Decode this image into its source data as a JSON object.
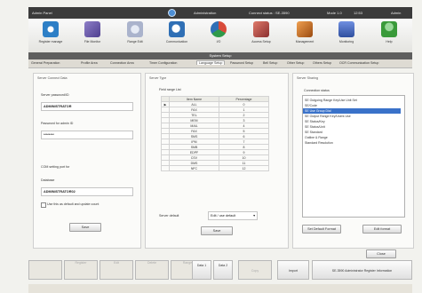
{
  "titlebar": {
    "left": "Admin Panel",
    "center": "Administration",
    "status": "Connect status : SE-3590",
    "mode": "Mode 1.0",
    "clock": "12:53",
    "right": "Admin"
  },
  "toolbar": [
    {
      "label": "Register manage",
      "icon": "register-icon",
      "color": "#2d7fc6"
    },
    {
      "label": "File Monitor",
      "icon": "user-icon",
      "color": "#6b5aa8"
    },
    {
      "label": "Range Edit",
      "icon": "range-icon",
      "color": "#aab3cc"
    },
    {
      "label": "Communication",
      "icon": "search-icon",
      "color": "#2f6fb5"
    },
    {
      "label": "I/O",
      "icon": "io-icon",
      "color": "#2f9a4a"
    },
    {
      "label": "Access Setup",
      "icon": "access-icon",
      "color": "#b04040"
    },
    {
      "label": "Management",
      "icon": "management-icon",
      "color": "#c46c20"
    },
    {
      "label": "Monitoring",
      "icon": "monitor-icon",
      "color": "#3f5fb5"
    },
    {
      "label": "Help",
      "icon": "help-icon",
      "color": "#3a9a3a"
    }
  ],
  "section_title": "System Setup",
  "tabs": [
    "General Preparation",
    "Profile Area",
    "Connection Area",
    "Timer Configuration",
    "Language Setup",
    "Password Setup",
    "Bell Setup",
    "Other Setup",
    "Others Setup",
    "OCR Communication Setup"
  ],
  "active_tab_index": 4,
  "left_panel": {
    "title": "Server Connect Data",
    "field1_label": "Server password/ID",
    "field1_value": "ADMINISTRATOR",
    "field2_label": "Password for admin ID",
    "field2_value": "********",
    "field3_label": "COM setting port for",
    "field4_label": "Database",
    "field4_value": "ADMINISTRATOR02",
    "checkbox_label": "Use this as default and update count",
    "save_label": "Save"
  },
  "middle_panel": {
    "title": "Server Type",
    "list_label": "Field range List",
    "columns": [
      "Item Name",
      "Percentage"
    ],
    "rows": [
      {
        "name": "ALL",
        "value": "0"
      },
      {
        "name": "FAX",
        "value": "1"
      },
      {
        "name": "TEL",
        "value": "2"
      },
      {
        "name": "MEM",
        "value": "3"
      },
      {
        "name": "MAIL",
        "value": "4"
      },
      {
        "name": "FAX",
        "value": "5"
      },
      {
        "name": "SMS",
        "value": "6"
      },
      {
        "name": "IPM",
        "value": "7"
      },
      {
        "name": "SMB",
        "value": "8"
      },
      {
        "name": "EDPF",
        "value": "9"
      },
      {
        "name": "CSV",
        "value": "10"
      },
      {
        "name": "DMS",
        "value": "11"
      },
      {
        "name": "NFC",
        "value": "12"
      }
    ],
    "dropdown_label": "Server default",
    "dropdown_value": "Edit / use default",
    "save_label": "Save"
  },
  "right_panel": {
    "title": "Server Sharing",
    "list_label": "Connection status",
    "items": [
      "SE Outgoing Range Key/Use Unit Set",
      "SE/Code",
      "SE Use Group Dial",
      "SE Output Range Key/Users Use",
      "SE Status/Key",
      "SE Status/Unit",
      "SE Standard",
      "Outline & Range",
      "Standard Resolution"
    ],
    "selected_index": 2,
    "default_label": "Set Default Format",
    "edit_label": "Edit format"
  },
  "close_label": "Close",
  "bottom_bar": [
    {
      "label": "",
      "enabled": false
    },
    {
      "label": "Register",
      "enabled": false
    },
    {
      "label": "Edit",
      "enabled": false
    },
    {
      "label": "Delete",
      "enabled": false
    },
    {
      "label": "Range",
      "enabled": false
    },
    {
      "label": "Data 1",
      "enabled": true
    },
    {
      "label": "Data 2",
      "enabled": true
    },
    {
      "label": "Copy",
      "enabled": false
    },
    {
      "label": "Import",
      "enabled": true
    },
    {
      "label": "SE-3590 Administrator Register Information",
      "enabled": true
    }
  ]
}
